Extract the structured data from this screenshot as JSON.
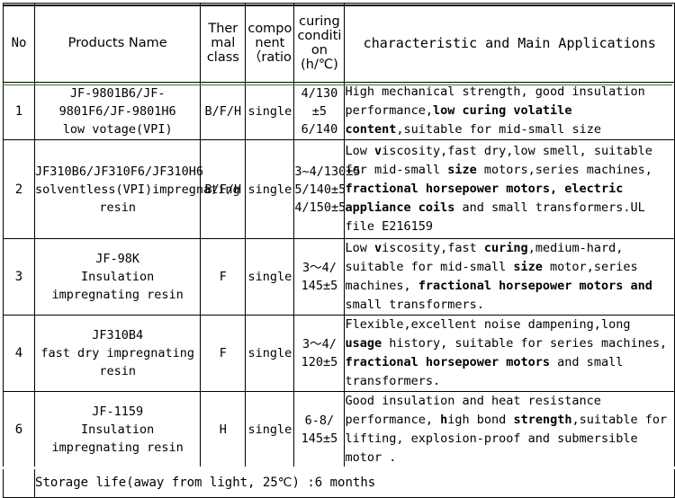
{
  "table": {
    "headers": [
      {
        "key": "no",
        "label": "No"
      },
      {
        "key": "name",
        "label": "Products Name"
      },
      {
        "key": "thermal",
        "label": "Ther\nmal\nclass"
      },
      {
        "key": "component",
        "label": "compo\nnent\n（ratio"
      },
      {
        "key": "curing",
        "label": "curing\nconditi\non\n(h/℃)"
      },
      {
        "key": "characteristic",
        "label": "characteristic and Main Applications"
      }
    ],
    "rows": [
      {
        "no": "1",
        "name": "JF-9801B6/JF-9801F6/JF-9801H6\nlow votage(VPI)",
        "thermal": "B/F/H",
        "component": "single",
        "curing": "4/130\n±5\n6/140",
        "desc_runs": [
          {
            "t": "High mechanical strength, good insulation performance,",
            "b": false
          },
          {
            "t": "low curing volatile content",
            "b": true
          },
          {
            "t": ",suitable for mid-small size",
            "b": false
          }
        ]
      },
      {
        "no": "2",
        "name": "JF310B6/JF310F6/JF310H6\nsolventless(VPI)impregnating resin",
        "thermal": "B/F/H",
        "component": "single",
        "curing": "3~4/130±5\n5/140±5\n4/150±5",
        "desc_runs": [
          {
            "t": "Low ",
            "b": false
          },
          {
            "t": "v",
            "b": true
          },
          {
            "t": "iscosity,fast dry,low smell, suitable for mid-small ",
            "b": false
          },
          {
            "t": "size",
            "b": true
          },
          {
            "t": " motors,series machines, ",
            "b": false
          },
          {
            "t": "fractional horsepower motors, electric appliance coils",
            "b": true
          },
          {
            "t": " and small transformers.UL file E216159",
            "b": false
          }
        ]
      },
      {
        "no": "3",
        "name": "JF-98K\nInsulation\nimpregnating resin",
        "thermal": "F",
        "component": "single",
        "curing": "3～4/\n145±5",
        "desc_runs": [
          {
            "t": "Low ",
            "b": false
          },
          {
            "t": "v",
            "b": true
          },
          {
            "t": "iscosity,fast ",
            "b": false
          },
          {
            "t": "curing",
            "b": true
          },
          {
            "t": ",medium-hard, suitable for mid-small ",
            "b": false
          },
          {
            "t": "size",
            "b": true
          },
          {
            "t": " motor,series machines, ",
            "b": false
          },
          {
            "t": "fractional horsepower motors and",
            "b": true
          },
          {
            "t": " small transformers.",
            "b": false
          }
        ]
      },
      {
        "no": "4",
        "name": "JF310B4\nfast dry impregnating resin",
        "thermal": "F",
        "component": "single",
        "curing": "3～4/\n120±5",
        "desc_runs": [
          {
            "t": "Flexible,excellent noise dampening,long ",
            "b": false
          },
          {
            "t": "usage",
            "b": true
          },
          {
            "t": " history, suitable for series machines, ",
            "b": false
          },
          {
            "t": "fractional horsepower motors",
            "b": true
          },
          {
            "t": " and small transformers.",
            "b": false
          }
        ]
      },
      {
        "no": "6",
        "name": "JF-1159\nInsulation\nimpregnating resin",
        "thermal": "H",
        "component": "single",
        "curing": "6-8/\n145±5",
        "desc_runs": [
          {
            "t": "Good insulation and heat resistance performance, ",
            "b": false
          },
          {
            "t": "h",
            "b": true
          },
          {
            "t": "igh bond ",
            "b": false
          },
          {
            "t": "strength",
            "b": true
          },
          {
            "t": ",suitable for lifting, explosion-proof and submersible motor .",
            "b": false
          }
        ]
      }
    ],
    "footnote": "Storage life(away from light, 25℃) :6 months",
    "colors": {
      "footnote_background": "#ffff00",
      "header_separator": "#3a7d2c",
      "grid_line": "#000000",
      "page_background": "#ffffff"
    }
  }
}
